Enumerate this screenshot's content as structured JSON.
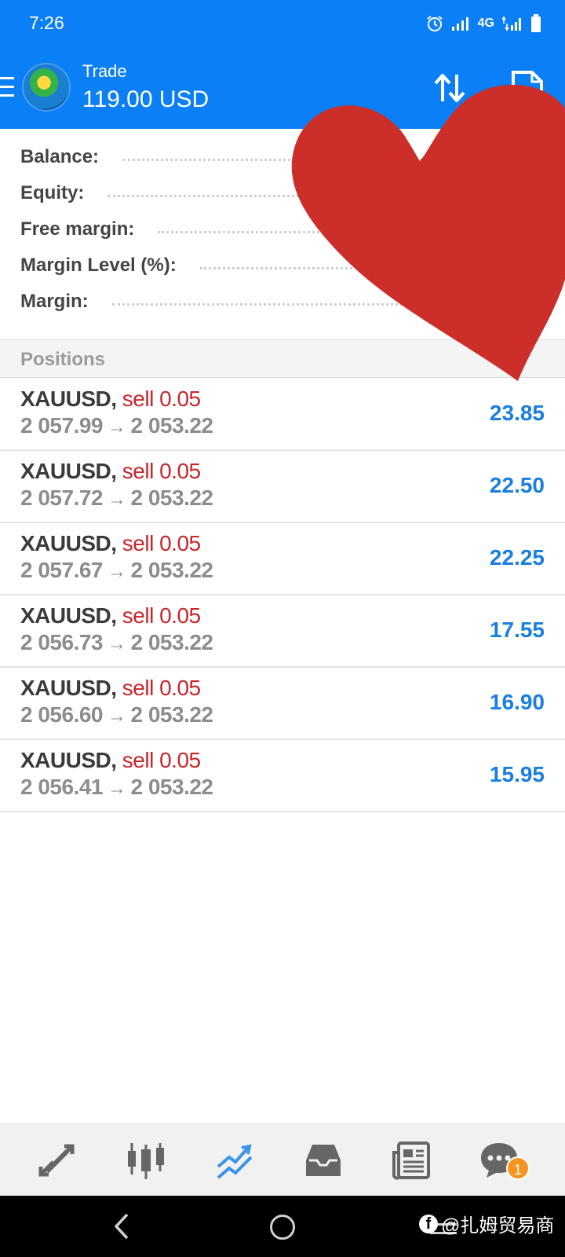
{
  "status_bar": {
    "time": "7:26",
    "network": "4G"
  },
  "app_bar": {
    "title": "Trade",
    "balance": "119.00 USD"
  },
  "summary": {
    "rows": [
      {
        "label": "Balance:"
      },
      {
        "label": "Equity:"
      },
      {
        "label": "Free margin:"
      },
      {
        "label": "Margin Level (%):"
      },
      {
        "label": "Margin:"
      }
    ]
  },
  "positions": {
    "header": "Positions",
    "arrow": "→",
    "items": [
      {
        "symbol": "XAUUSD,",
        "side": "sell 0.05",
        "open_price": "2 057.99",
        "current_price": "2 053.22",
        "profit": "23.85"
      },
      {
        "symbol": "XAUUSD,",
        "side": "sell 0.05",
        "open_price": "2 057.72",
        "current_price": "2 053.22",
        "profit": "22.50"
      },
      {
        "symbol": "XAUUSD,",
        "side": "sell 0.05",
        "open_price": "2 057.67",
        "current_price": "2 053.22",
        "profit": "22.25"
      },
      {
        "symbol": "XAUUSD,",
        "side": "sell 0.05",
        "open_price": "2 056.73",
        "current_price": "2 053.22",
        "profit": "17.55"
      },
      {
        "symbol": "XAUUSD,",
        "side": "sell 0.05",
        "open_price": "2 056.60",
        "current_price": "2 053.22",
        "profit": "16.90"
      },
      {
        "symbol": "XAUUSD,",
        "side": "sell 0.05",
        "open_price": "2 056.41",
        "current_price": "2 053.22",
        "profit": "15.95"
      }
    ]
  },
  "bottom_nav": {
    "items": [
      {
        "icon": "quotes-icon"
      },
      {
        "icon": "chart-icon"
      },
      {
        "icon": "trade-icon",
        "active": true
      },
      {
        "icon": "history-icon"
      },
      {
        "icon": "news-icon"
      },
      {
        "icon": "messages-icon"
      }
    ],
    "messages_badge": "1"
  },
  "watermark": {
    "text": "@扎姆贸易商"
  },
  "colors": {
    "header_blue": "#0a7ff6",
    "sell_red": "#c7262b",
    "profit_blue": "#1a7fe0",
    "heart_red": "#cc2e2a",
    "badge_orange": "#f7941d"
  }
}
